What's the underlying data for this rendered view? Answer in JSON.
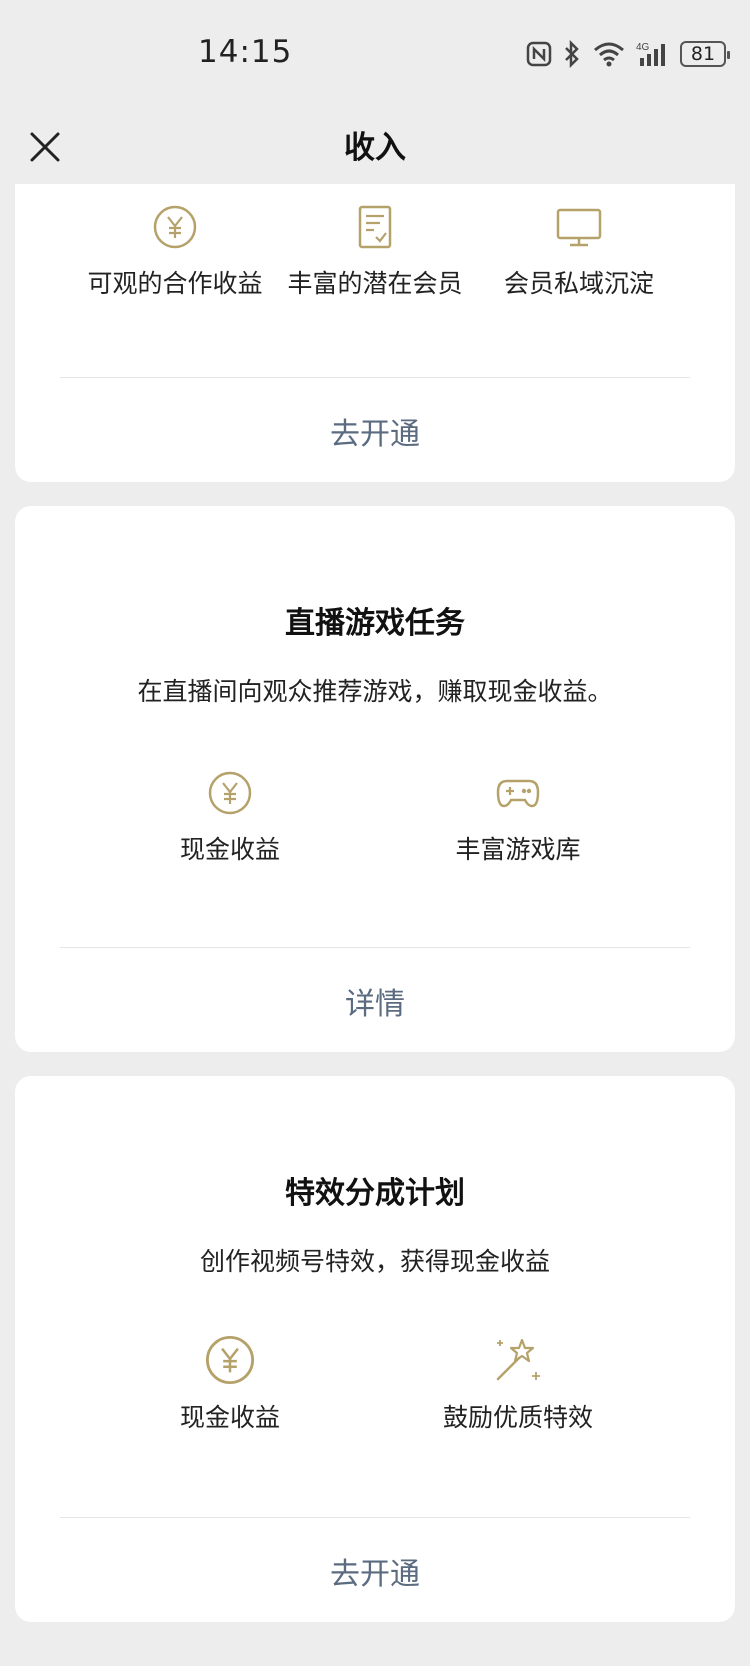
{
  "status_bar": {
    "time": "14:15",
    "battery": "81",
    "network": "4G"
  },
  "nav": {
    "title": "收入",
    "close_icon": "close-icon"
  },
  "cards": [
    {
      "features": [
        {
          "icon": "yen-circle-icon",
          "label": "可观的合作收益"
        },
        {
          "icon": "document-check-icon",
          "label": "丰富的潜在会员"
        },
        {
          "icon": "monitor-icon",
          "label": "会员私域沉淀"
        }
      ],
      "action": "去开通"
    },
    {
      "title": "直播游戏任务",
      "description": "在直播间向观众推荐游戏，赚取现金收益。",
      "features": [
        {
          "icon": "yen-circle-icon",
          "label": "现金收益"
        },
        {
          "icon": "gamepad-icon",
          "label": "丰富游戏库"
        }
      ],
      "action": "详情"
    },
    {
      "title": "特效分成计划",
      "description": "创作视频号特效，获得现金收益",
      "features": [
        {
          "icon": "yen-circle-icon",
          "label": "现金收益"
        },
        {
          "icon": "magic-wand-icon",
          "label": "鼓励优质特效"
        }
      ],
      "action": "去开通"
    }
  ],
  "colors": {
    "accent_gold": "#B5A26A",
    "link_gray_blue": "#5B6B80",
    "background": "#EDEDED",
    "card": "#FFFFFF"
  }
}
